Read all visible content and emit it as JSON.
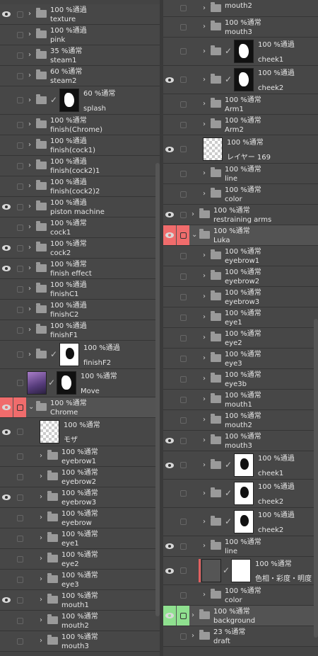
{
  "left_layers": [
    {
      "eye": true,
      "indent": 1,
      "type": "folder",
      "line1": "100 %通過",
      "line2": "texture",
      "height": 29
    },
    {
      "eye": false,
      "indent": 1,
      "type": "folder",
      "line1": "100 %通過",
      "line2": "pink",
      "height": 29
    },
    {
      "eye": false,
      "indent": 1,
      "type": "folder",
      "line1": "35 %通常",
      "line2": "steam1",
      "height": 29
    },
    {
      "eye": false,
      "indent": 1,
      "type": "folder",
      "line1": "60 %通常",
      "line2": "steam2",
      "height": 29
    },
    {
      "eye": false,
      "indent": 1,
      "type": "folder_thumb",
      "thumb": "black",
      "line1": "60 %通常",
      "line2": "splash",
      "height": 40
    },
    {
      "eye": false,
      "indent": 1,
      "type": "folder",
      "line1": "100 %通常",
      "line2": "finish(Chrome)",
      "height": 29
    },
    {
      "eye": false,
      "indent": 1,
      "type": "folder",
      "line1": "100 %通過",
      "line2": "finish(cock1)",
      "height": 29
    },
    {
      "eye": false,
      "indent": 1,
      "type": "folder",
      "line1": "100 %通過",
      "line2": "finish(cock2)1",
      "height": 29
    },
    {
      "eye": false,
      "indent": 1,
      "type": "folder",
      "line1": "100 %通過",
      "line2": "finish(cock2)2",
      "height": 29
    },
    {
      "eye": true,
      "indent": 1,
      "type": "folder",
      "line1": "100 %通過",
      "line2": "piston machine",
      "height": 29
    },
    {
      "eye": false,
      "indent": 1,
      "type": "folder",
      "line1": "100 %通常",
      "line2": "cock1",
      "height": 29
    },
    {
      "eye": true,
      "indent": 1,
      "type": "folder",
      "line1": "100 %通常",
      "line2": "cock2",
      "height": 29
    },
    {
      "eye": true,
      "indent": 1,
      "type": "folder",
      "line1": "100 %通常",
      "line2": "finish effect",
      "height": 29
    },
    {
      "eye": false,
      "indent": 1,
      "type": "folder",
      "line1": "100 %通過",
      "line2": "finishC1",
      "height": 29
    },
    {
      "eye": false,
      "indent": 1,
      "type": "folder",
      "line1": "100 %通過",
      "line2": "finishC2",
      "height": 29
    },
    {
      "eye": false,
      "indent": 1,
      "type": "folder",
      "line1": "100 %通過",
      "line2": "finishF1",
      "height": 29
    },
    {
      "eye": false,
      "indent": 1,
      "type": "folder_thumb",
      "thumb": "white",
      "line1": "100 %通過",
      "line2": "finishF2",
      "height": 40
    },
    {
      "eye": false,
      "indent": 1,
      "type": "layer_mask",
      "line1": "100 %通常",
      "line2": "Move",
      "height": 40
    },
    {
      "eye": true,
      "indent": 1,
      "type": "folder",
      "open": true,
      "highlight": "red",
      "line1": "100 %通常",
      "line2": "Chrome",
      "height": 29
    },
    {
      "eye": true,
      "indent": 2,
      "type": "layer",
      "thumb": "chk",
      "line1": "100 %通常",
      "line2": "モザ",
      "height": 40
    },
    {
      "eye": false,
      "indent": 2,
      "type": "folder",
      "line1": "100 %通常",
      "line2": "eyebrow1",
      "height": 29
    },
    {
      "eye": false,
      "indent": 2,
      "type": "folder",
      "line1": "100 %通常",
      "line2": "eyebrow2",
      "height": 29
    },
    {
      "eye": true,
      "indent": 2,
      "type": "folder",
      "line1": "100 %通常",
      "line2": "eyebrow3",
      "height": 29
    },
    {
      "eye": false,
      "indent": 2,
      "type": "folder",
      "line1": "100 %通常",
      "line2": "eyebrow",
      "height": 29
    },
    {
      "eye": false,
      "indent": 2,
      "type": "folder",
      "line1": "100 %通常",
      "line2": "eye1",
      "height": 29
    },
    {
      "eye": false,
      "indent": 2,
      "type": "folder",
      "line1": "100 %通常",
      "line2": "eye2",
      "height": 29
    },
    {
      "eye": false,
      "indent": 2,
      "type": "folder",
      "line1": "100 %通常",
      "line2": "eye3",
      "height": 29
    },
    {
      "eye": true,
      "indent": 2,
      "type": "folder",
      "line1": "100 %通常",
      "line2": "mouth1",
      "height": 29
    },
    {
      "eye": false,
      "indent": 2,
      "type": "folder",
      "line1": "100 %通常",
      "line2": "mouth2",
      "height": 29
    },
    {
      "eye": false,
      "indent": 2,
      "type": "folder",
      "line1": "100 %通常",
      "line2": "mouth3",
      "height": 29
    }
  ],
  "right_layers": [
    {
      "eye": false,
      "indent": 2,
      "type": "folder",
      "line1": "",
      "line2": "mouth2",
      "height": 24
    },
    {
      "eye": false,
      "indent": 2,
      "type": "folder",
      "line1": "100 %通常",
      "line2": "mouth3",
      "height": 29
    },
    {
      "eye": false,
      "indent": 2,
      "type": "folder_thumb",
      "thumb": "black",
      "line1": "100 %通過",
      "line2": "cheek1",
      "height": 40
    },
    {
      "eye": true,
      "indent": 2,
      "type": "folder_thumb",
      "thumb": "black",
      "line1": "100 %通過",
      "line2": "cheek2",
      "height": 40
    },
    {
      "eye": false,
      "indent": 2,
      "type": "folder",
      "line1": "100 %通常",
      "line2": "Arm1",
      "height": 29
    },
    {
      "eye": false,
      "indent": 2,
      "type": "folder",
      "line1": "100 %通常",
      "line2": "Arm2",
      "height": 29
    },
    {
      "eye": true,
      "indent": 2,
      "type": "layer",
      "thumb": "chk",
      "line1": "100 %通常",
      "line2": "レイヤー 169",
      "height": 40
    },
    {
      "eye": false,
      "indent": 2,
      "type": "folder",
      "line1": "100 %通常",
      "line2": "line",
      "height": 29
    },
    {
      "eye": false,
      "indent": 2,
      "type": "folder",
      "line1": "100 %通常",
      "line2": "color",
      "height": 29
    },
    {
      "eye": true,
      "indent": 1,
      "type": "folder",
      "line1": "100 %通常",
      "line2": "restraining arms",
      "height": 29
    },
    {
      "eye": true,
      "indent": 1,
      "type": "folder",
      "open": true,
      "highlight": "red",
      "line1": "100 %通常",
      "line2": "Luka",
      "height": 29
    },
    {
      "eye": false,
      "indent": 2,
      "type": "folder",
      "line1": "100 %通常",
      "line2": "eyebrow1",
      "height": 29
    },
    {
      "eye": false,
      "indent": 2,
      "type": "folder",
      "line1": "100 %通常",
      "line2": "eyebrow2",
      "height": 29
    },
    {
      "eye": false,
      "indent": 2,
      "type": "folder",
      "line1": "100 %通常",
      "line2": "eyebrow3",
      "height": 29
    },
    {
      "eye": false,
      "indent": 2,
      "type": "folder",
      "line1": "100 %通常",
      "line2": "eye1",
      "height": 29
    },
    {
      "eye": false,
      "indent": 2,
      "type": "folder",
      "line1": "100 %通常",
      "line2": "eye2",
      "height": 29
    },
    {
      "eye": false,
      "indent": 2,
      "type": "folder",
      "line1": "100 %通常",
      "line2": "eye3",
      "height": 29
    },
    {
      "eye": false,
      "indent": 2,
      "type": "folder",
      "line1": "100 %通常",
      "line2": "eye3b",
      "height": 29
    },
    {
      "eye": false,
      "indent": 2,
      "type": "folder",
      "line1": "100 %通常",
      "line2": "mouth1",
      "height": 29
    },
    {
      "eye": false,
      "indent": 2,
      "type": "folder",
      "line1": "100 %通常",
      "line2": "mouth2",
      "height": 29
    },
    {
      "eye": true,
      "indent": 2,
      "type": "folder",
      "line1": "100 %通常",
      "line2": "mouth3",
      "height": 29
    },
    {
      "eye": true,
      "indent": 2,
      "type": "folder_thumb",
      "thumb": "white",
      "line1": "100 %通過",
      "line2": "cheek1",
      "height": 40
    },
    {
      "eye": false,
      "indent": 2,
      "type": "folder_thumb",
      "thumb": "white",
      "line1": "100 %通過",
      "line2": "cheek2",
      "height": 40
    },
    {
      "eye": false,
      "indent": 2,
      "type": "folder_thumb",
      "thumb": "white",
      "line1": "100 %通過",
      "line2": "cheek2",
      "height": 40
    },
    {
      "eye": true,
      "indent": 2,
      "type": "folder",
      "line1": "100 %通常",
      "line2": "line",
      "height": 29
    },
    {
      "eye": true,
      "indent": 2,
      "type": "adjust",
      "line1": "100 %通常",
      "line2": "色相・彩度・明度",
      "height": 40
    },
    {
      "eye": false,
      "indent": 2,
      "type": "folder",
      "line1": "100 %通常",
      "line2": "color",
      "height": 29
    },
    {
      "eye": true,
      "indent": 1,
      "type": "folder",
      "highlight": "green",
      "line1": "100 %通常",
      "line2": "background",
      "height": 29
    },
    {
      "eye": false,
      "indent": 1,
      "type": "folder",
      "line1": "23 %通常",
      "line2": "draft",
      "height": 29
    }
  ]
}
